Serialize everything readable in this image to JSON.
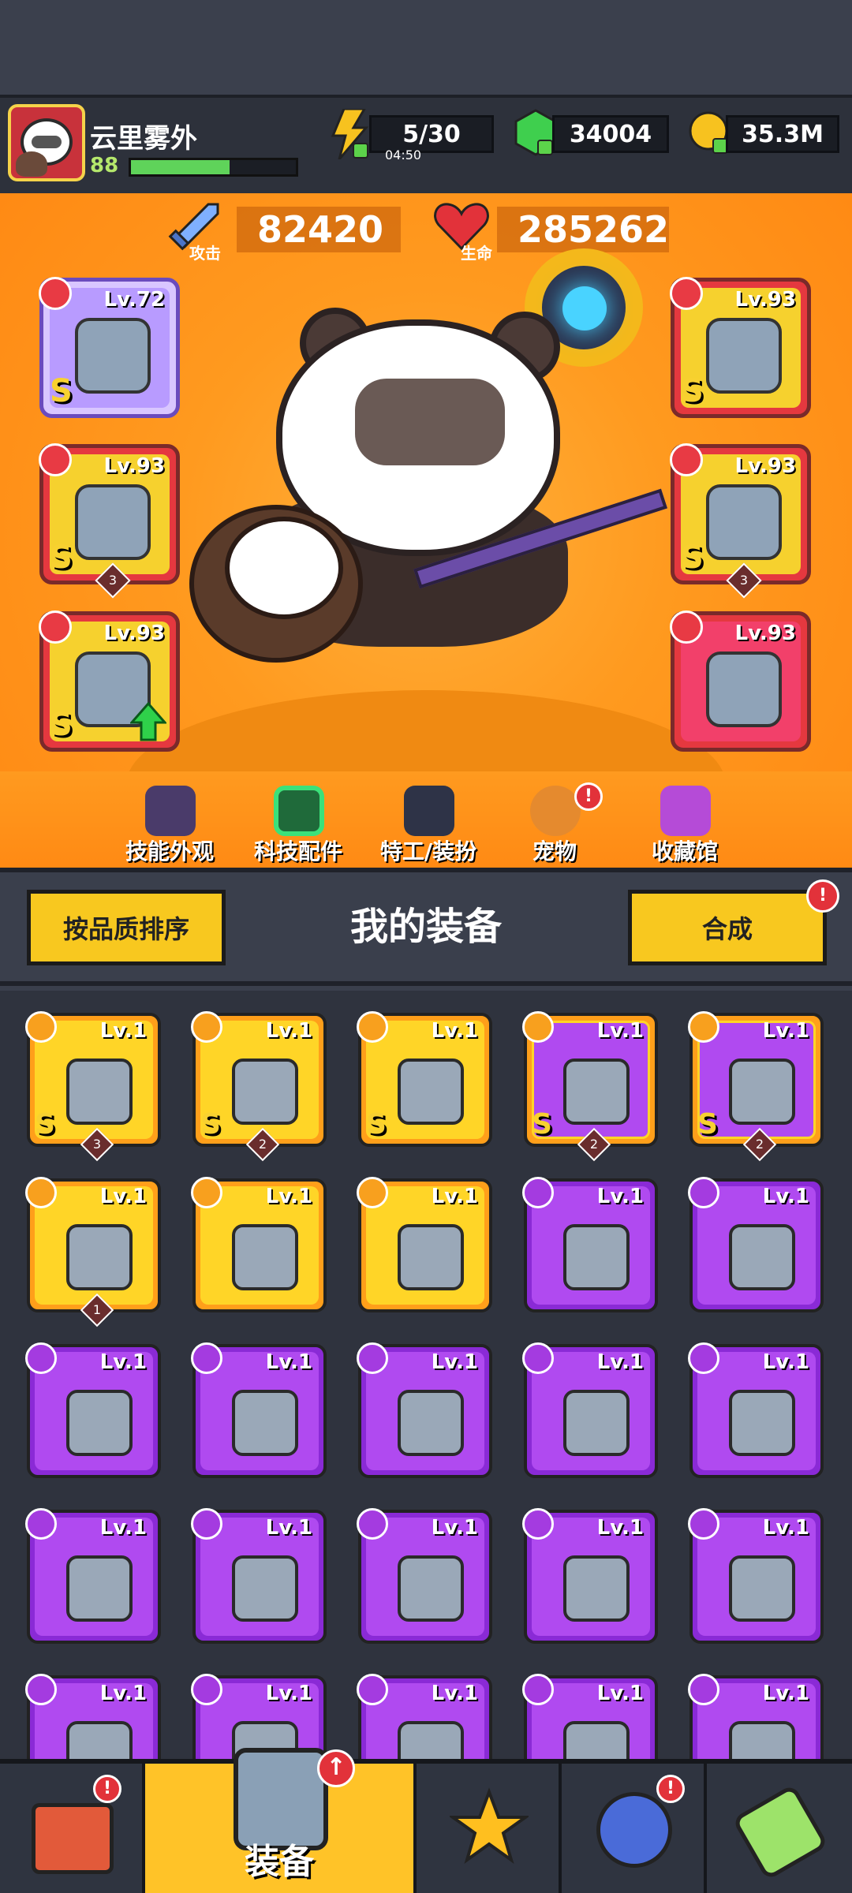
{
  "player": {
    "name": "云里雾外",
    "level": "88",
    "xp_fraction": 0.6
  },
  "resources": {
    "energy": "5/30",
    "energy_timer": "04:50",
    "gems": "34004",
    "coins": "35.3M"
  },
  "stats": {
    "attack_value": "82420",
    "attack_label": "攻击",
    "hp_value": "285262",
    "hp_label": "生命"
  },
  "equipped": [
    {
      "slot": "weapon",
      "level": "Lv.72",
      "grade": "S",
      "count": ""
    },
    {
      "slot": "necklace",
      "level": "Lv.93",
      "grade": "S",
      "count": "3"
    },
    {
      "slot": "glove",
      "level": "Lv.93",
      "grade": "S",
      "count": ""
    },
    {
      "slot": "armor",
      "level": "Lv.93",
      "grade": "S",
      "count": ""
    },
    {
      "slot": "belt",
      "level": "Lv.93",
      "grade": "S",
      "count": "3"
    },
    {
      "slot": "boots",
      "level": "Lv.93",
      "grade": "",
      "count": ""
    }
  ],
  "features": [
    {
      "label": "技能外观"
    },
    {
      "label": "科技配件"
    },
    {
      "label": "特工/装扮"
    },
    {
      "label": "宠物",
      "badge": "!"
    },
    {
      "label": "收藏馆"
    }
  ],
  "equipment_section": {
    "title": "我的装备",
    "sort_button": "按品质排序",
    "merge_button": "合成",
    "merge_badge": "!"
  },
  "inventory": [
    {
      "level": "Lv.1",
      "rarity": "gold",
      "grade": "S",
      "count": "3"
    },
    {
      "level": "Lv.1",
      "rarity": "gold",
      "grade": "S",
      "count": "2"
    },
    {
      "level": "Lv.1",
      "rarity": "gold",
      "grade": "S",
      "count": ""
    },
    {
      "level": "Lv.1",
      "rarity": "goldp",
      "grade": "S",
      "count": "2"
    },
    {
      "level": "Lv.1",
      "rarity": "goldp",
      "grade": "S",
      "count": "2"
    },
    {
      "level": "Lv.1",
      "rarity": "gold",
      "grade": "",
      "count": "1"
    },
    {
      "level": "Lv.1",
      "rarity": "gold",
      "grade": "",
      "count": ""
    },
    {
      "level": "Lv.1",
      "rarity": "gold",
      "grade": "",
      "count": ""
    },
    {
      "level": "Lv.1",
      "rarity": "purple",
      "grade": "",
      "count": ""
    },
    {
      "level": "Lv.1",
      "rarity": "purple",
      "grade": "",
      "count": ""
    },
    {
      "level": "Lv.1",
      "rarity": "purple",
      "grade": "",
      "count": ""
    },
    {
      "level": "Lv.1",
      "rarity": "purple",
      "grade": "",
      "count": ""
    },
    {
      "level": "Lv.1",
      "rarity": "purple",
      "grade": "",
      "count": ""
    },
    {
      "level": "Lv.1",
      "rarity": "purple",
      "grade": "",
      "count": ""
    },
    {
      "level": "Lv.1",
      "rarity": "purple",
      "grade": "",
      "count": ""
    },
    {
      "level": "Lv.1",
      "rarity": "purple",
      "grade": "",
      "count": ""
    },
    {
      "level": "Lv.1",
      "rarity": "purple",
      "grade": "",
      "count": ""
    },
    {
      "level": "Lv.1",
      "rarity": "purple",
      "grade": "",
      "count": ""
    },
    {
      "level": "Lv.1",
      "rarity": "purple",
      "grade": "",
      "count": ""
    },
    {
      "level": "Lv.1",
      "rarity": "purple",
      "grade": "",
      "count": ""
    },
    {
      "level": "Lv.1",
      "rarity": "purple",
      "grade": "",
      "count": ""
    },
    {
      "level": "Lv.1",
      "rarity": "purple",
      "grade": "",
      "count": ""
    },
    {
      "level": "Lv.1",
      "rarity": "purple",
      "grade": "",
      "count": ""
    },
    {
      "level": "Lv.1",
      "rarity": "purple",
      "grade": "",
      "count": ""
    },
    {
      "level": "Lv.1",
      "rarity": "purple",
      "grade": "",
      "count": ""
    }
  ],
  "bottom_nav": {
    "active_label": "装备",
    "shop_badge": "!",
    "skin_badge": "!"
  }
}
